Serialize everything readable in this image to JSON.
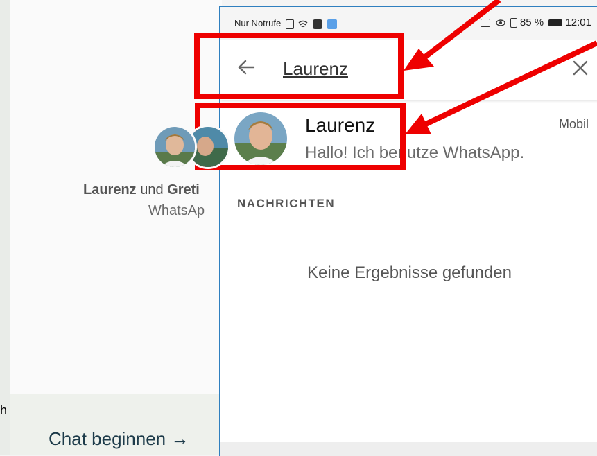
{
  "background": {
    "participants_line": {
      "name1": "Laurenz",
      "connector": " und ",
      "name2": "Greti"
    },
    "line2": "WhatsAp",
    "bottom_action": "Chat beginnen →",
    "left_edge_char": "h"
  },
  "statusbar": {
    "left_text": "Nur Notrufe",
    "battery_text": "85 %",
    "time": "12:01"
  },
  "search": {
    "value": "Laurenz"
  },
  "contact": {
    "name": "Laurenz",
    "type": "Mobil",
    "status": "Hallo! Ich benutze WhatsApp."
  },
  "messages_section": {
    "header": "NACHRICHTEN",
    "empty_text": "Keine Ergebnisse gefunden"
  },
  "colors": {
    "annotation_red": "#ee0000",
    "phone_border": "#2f7fbf"
  },
  "icons": {
    "back": "arrow-left-icon",
    "close": "close-icon",
    "wifi": "wifi-icon",
    "battery": "battery-icon",
    "vibrate": "vibrate-icon",
    "eye": "eye-icon"
  }
}
